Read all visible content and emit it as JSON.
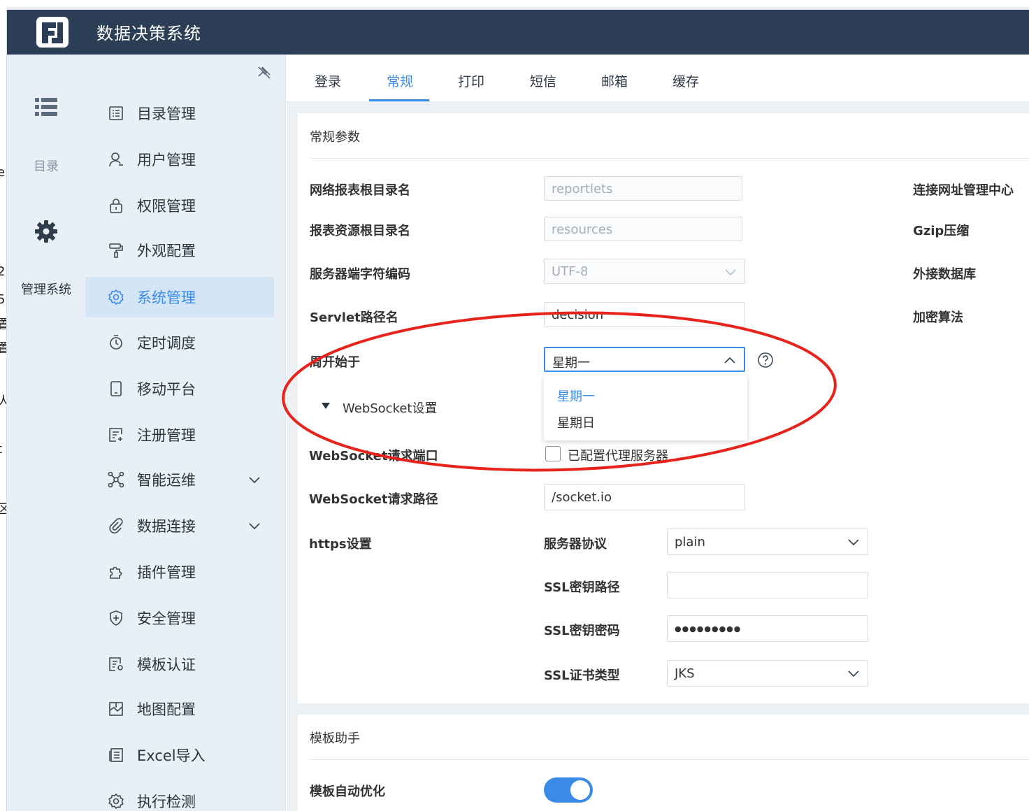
{
  "header": {
    "title": "数据决策系统",
    "logo_icon": "fanruan-logo-icon"
  },
  "left_edge_chars": [
    "e",
    "2",
    "5",
    "置",
    "置",
    "人",
    "t",
    "区"
  ],
  "rail": {
    "items": [
      {
        "icon": "list-icon",
        "label": "目录"
      },
      {
        "icon": "gear-icon",
        "label": "管理系统"
      }
    ]
  },
  "menu": {
    "items": [
      {
        "icon": "catalog-icon",
        "label": "目录管理"
      },
      {
        "icon": "user-icon",
        "label": "用户管理"
      },
      {
        "icon": "lock-icon",
        "label": "权限管理"
      },
      {
        "icon": "paint-roller-icon",
        "label": "外观配置"
      },
      {
        "icon": "settings-icon",
        "label": "系统管理",
        "active": true
      },
      {
        "icon": "timer-icon",
        "label": "定时调度"
      },
      {
        "icon": "mobile-icon",
        "label": "移动平台"
      },
      {
        "icon": "register-icon",
        "label": "注册管理"
      },
      {
        "icon": "ops-icon",
        "label": "智能运维",
        "expandable": true
      },
      {
        "icon": "link-icon",
        "label": "数据连接",
        "expandable": true
      },
      {
        "icon": "plugin-icon",
        "label": "插件管理"
      },
      {
        "icon": "shield-icon",
        "label": "安全管理"
      },
      {
        "icon": "template-cert-icon",
        "label": "模板认证"
      },
      {
        "icon": "map-icon",
        "label": "地图配置"
      },
      {
        "icon": "excel-import-icon",
        "label": "Excel导入"
      },
      {
        "icon": "check-icon",
        "label": "执行检测"
      }
    ]
  },
  "tabs": [
    "登录",
    "常规",
    "打印",
    "短信",
    "邮箱",
    "缓存"
  ],
  "active_tab": "常规",
  "general": {
    "section_title": "常规参数",
    "web_root_label": "网络报表根目录名",
    "web_root_value": "reportlets",
    "res_root_label": "报表资源根目录名",
    "res_root_value": "resources",
    "charset_label": "服务器端字符编码",
    "charset_value": "UTF-8",
    "servlet_label": "Servlet路径名",
    "servlet_value": "decision",
    "week_label": "周开始于",
    "week_value": "星期一",
    "week_options": [
      "星期一",
      "星期日"
    ],
    "websocket_toggle": "WebSocket设置",
    "ws_port_label": "WebSocket请求端口",
    "proxy_label": "已配置代理服务器",
    "proxy_checked": false,
    "ws_path_label": "WebSocket请求路径",
    "ws_path_value": "/socket.io",
    "https_label": "https设置",
    "protocol_label": "服务器协议",
    "protocol_value": "plain",
    "ssl_path_label": "SSL密钥路径",
    "ssl_path_value": "",
    "ssl_pwd_label": "SSL密钥密码",
    "ssl_pwd_value": "●●●●●●●●●",
    "ssl_type_label": "SSL证书类型",
    "ssl_type_value": "JKS",
    "right_labels": [
      "连接网址管理中心",
      "Gzip压缩",
      "外接数据库",
      "加密算法"
    ]
  },
  "template_helper": {
    "section_title": "模板助手",
    "auto_opt_label": "模板自动优化",
    "auto_opt_on": true
  },
  "colors": {
    "header_bg": "#2c3e56",
    "accent": "#3a8be8",
    "sidebar_bg": "#e9eff7",
    "annotation_red": "#e8231c"
  }
}
